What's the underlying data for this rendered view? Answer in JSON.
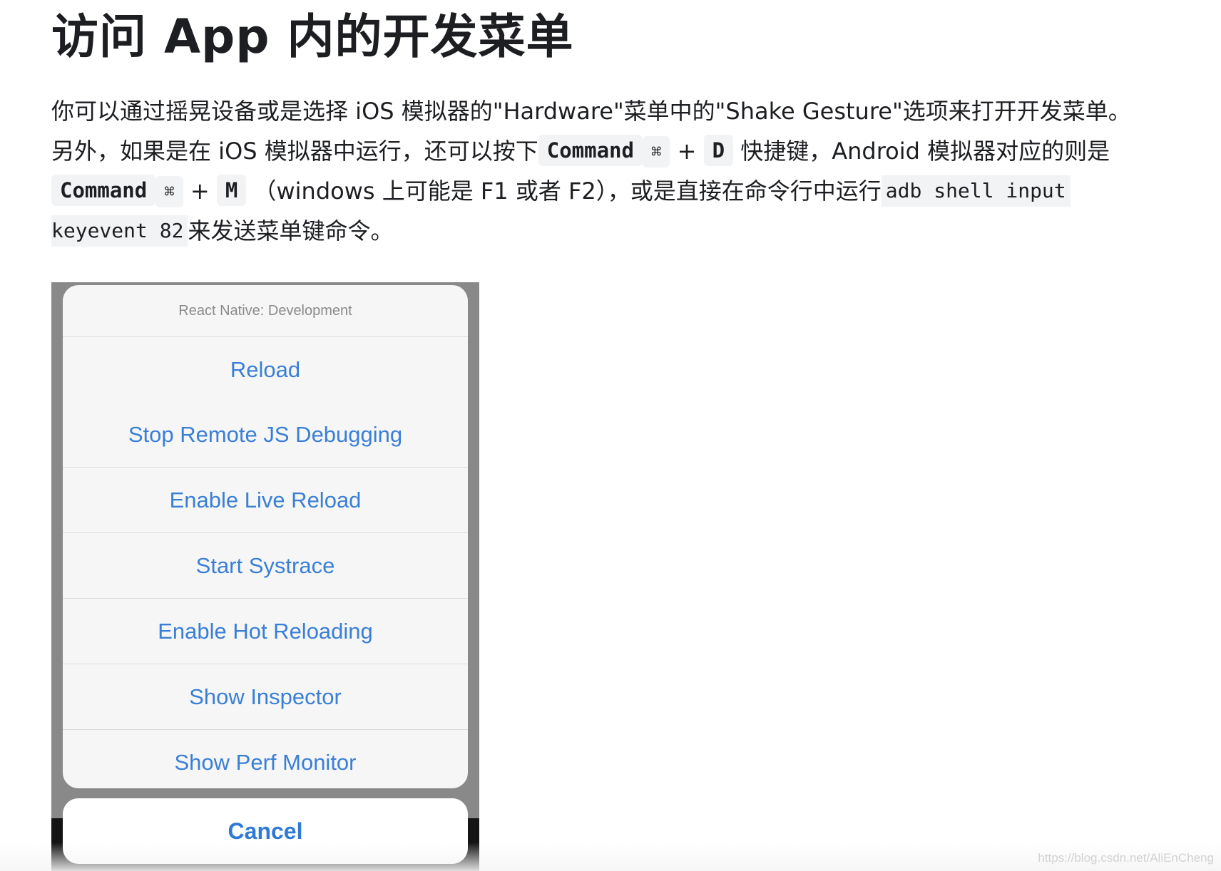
{
  "title": "访问 App 内的开发菜单",
  "paragraph": {
    "line1": "你可以通过摇晃设备或是选择 iOS 模拟器的\"Hardware\"菜单中的\"Shake Gesture\"选项来打开开发菜单。",
    "line2_prefix": "另外，如果是在 iOS 模拟器中运行，还可以按下",
    "kbd_command": "Command",
    "kbd_cmd_symbol": "⌘",
    "plus": "+",
    "kbd_d": "D",
    "line2_suffix": "快捷键，Android 模拟器对应的则是",
    "kbd_m": "M",
    "line3_middle": "（windows 上可能是 F1 或者 F2），或是直接在命令行中运行",
    "code_part1": "adb shell input",
    "code_part2": "keyevent 82",
    "line4_suffix": "来发送菜单键命令。"
  },
  "dev_menu": {
    "header": "React Native: Development",
    "items": [
      "Reload",
      "Stop Remote JS Debugging",
      "Enable Live Reload",
      "Start Systrace",
      "Enable Hot Reloading",
      "Show Inspector",
      "Show Perf Monitor"
    ],
    "cancel": "Cancel"
  },
  "watermark": "https://blog.csdn.net/AliEnCheng",
  "colors": {
    "menu_text": "#3a7fd6",
    "code_bg": "#f2f3f5"
  }
}
